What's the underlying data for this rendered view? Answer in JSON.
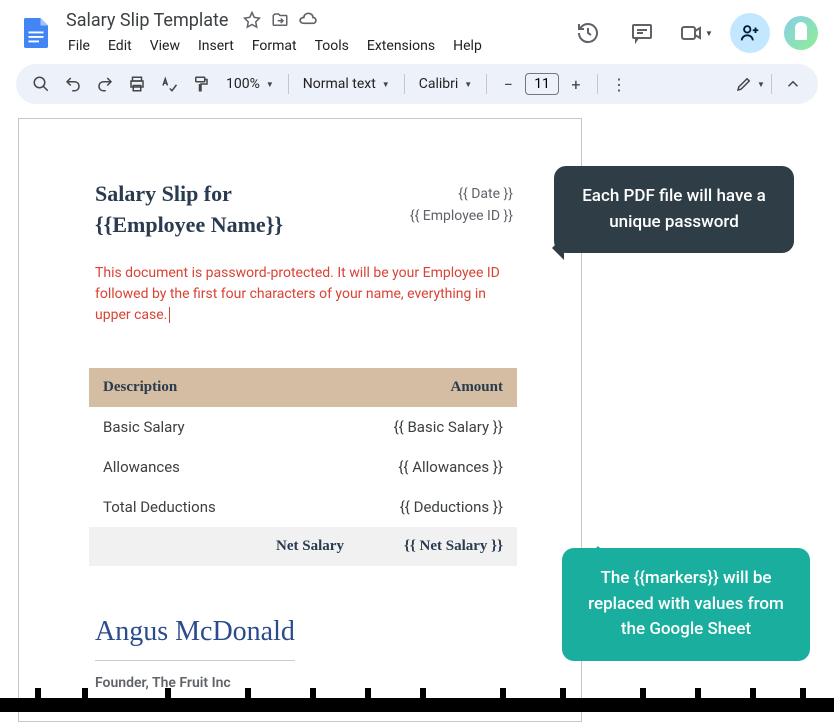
{
  "header": {
    "title": "Salary Slip Template",
    "menu": [
      "File",
      "Edit",
      "View",
      "Insert",
      "Format",
      "Tools",
      "Extensions",
      "Help"
    ]
  },
  "toolbar": {
    "zoom": "100%",
    "style": "Normal text",
    "font": "Calibri",
    "fontSize": "11"
  },
  "doc": {
    "title_line1": "Salary Slip for",
    "title_line2": "{{Employee Name}}",
    "meta_date": "{{ Date }}",
    "meta_empid": "{{ Employee ID }}",
    "warning": "This document is password-protected. It will be your Employee ID followed by the first four characters of your name, everything in upper case.",
    "col_desc": "Description",
    "col_amount": "Amount",
    "rows": [
      {
        "label": "Basic Salary",
        "value": "{{ Basic Salary }}"
      },
      {
        "label": "Allowances",
        "value": "{{ Allowances }}"
      },
      {
        "label": "Total Deductions",
        "value": "{{ Deductions }}"
      }
    ],
    "net_label": "Net Salary",
    "net_value": "{{ Net Salary }}",
    "signature": "Angus McDonald",
    "sig_title": "Founder, The Fruit Inc"
  },
  "callouts": {
    "dark": "Each PDF file will have a unique password",
    "teal": "The {{markers}} will be replaced with values from the Google Sheet"
  }
}
